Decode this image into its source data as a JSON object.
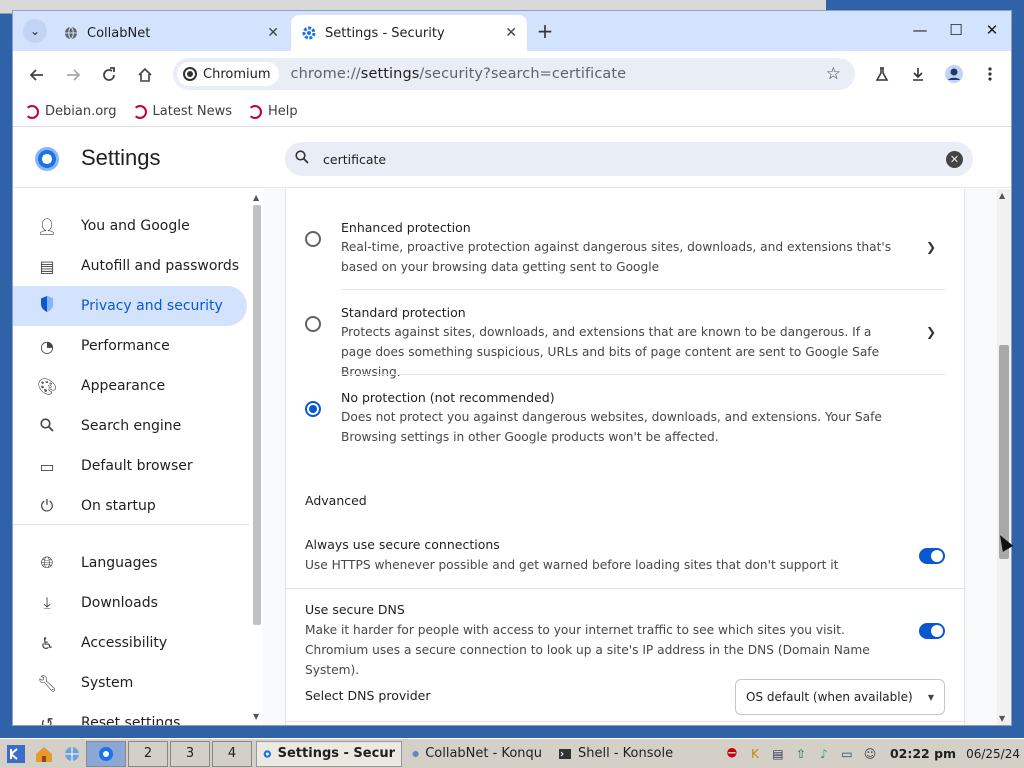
{
  "tabs": [
    {
      "title": "CollabNet",
      "close": "✕"
    },
    {
      "title": "Settings - Security",
      "close": "✕"
    }
  ],
  "tab_menu_glyph": "⌄",
  "new_tab_glyph": "+",
  "window_buttons": {
    "minimize": "—",
    "maximize": "☐",
    "close": "✕"
  },
  "omnibox": {
    "chip_label": "Chromium",
    "url_prefix": "chrome://",
    "url_host": "settings",
    "url_rest": "/security?search=certificate"
  },
  "bookmarks": [
    "Debian.org",
    "Latest News",
    "Help"
  ],
  "settings": {
    "title": "Settings",
    "search_value": "certificate"
  },
  "sidebar": {
    "items": [
      {
        "label": "You and Google",
        "icon": "person-icon"
      },
      {
        "label": "Autofill and passwords",
        "icon": "clipboard-icon"
      },
      {
        "label": "Privacy and security",
        "icon": "shield-icon",
        "active": true
      },
      {
        "label": "Performance",
        "icon": "speedometer-icon"
      },
      {
        "label": "Appearance",
        "icon": "palette-icon"
      },
      {
        "label": "Search engine",
        "icon": "search-icon"
      },
      {
        "label": "Default browser",
        "icon": "browser-icon"
      },
      {
        "label": "On startup",
        "icon": "power-icon"
      },
      {
        "label": "Languages",
        "icon": "globe-icon"
      },
      {
        "label": "Downloads",
        "icon": "download-icon"
      },
      {
        "label": "Accessibility",
        "icon": "accessibility-icon"
      },
      {
        "label": "System",
        "icon": "wrench-icon"
      },
      {
        "label": "Reset settings",
        "icon": "reset-icon"
      }
    ]
  },
  "protection": [
    {
      "title": "Enhanced protection",
      "desc": "Real-time, proactive protection against dangerous sites, downloads, and extensions that's based on your browsing data getting sent to Google",
      "checked": false
    },
    {
      "title": "Standard protection",
      "desc": "Protects against sites, downloads, and extensions that are known to be dangerous. If a page does something suspicious, URLs and bits of page content are sent to Google Safe Browsing.",
      "checked": false
    },
    {
      "title": "No protection (not recommended)",
      "desc": "Does not protect you against dangerous websites, downloads, and extensions. Your Safe Browsing settings in other Google products won't be affected.",
      "checked": true
    }
  ],
  "advanced": {
    "heading": "Advanced",
    "secure_connections": {
      "title": "Always use secure connections",
      "desc": "Use HTTPS whenever possible and get warned before loading sites that don't support it",
      "on": true
    },
    "secure_dns": {
      "title": "Use secure DNS",
      "desc": "Make it harder for people with access to your internet traffic to see which sites you visit. Chromium uses a secure connection to look up a site's IP address in the DNS (Domain Name System).",
      "on": true
    },
    "dns_provider": {
      "label": "Select DNS provider",
      "value": "OS default (when available)"
    }
  },
  "taskbar": {
    "desktops": [
      "2",
      "3",
      "4"
    ],
    "tasks": [
      "Settings - Secur",
      "CollabNet - Konqu",
      "Shell - Konsole"
    ],
    "clock": "02:22 pm",
    "date": "06/25/24"
  },
  "colors": {
    "accent": "#0b57d0",
    "tab_strip": "#d3e3fd",
    "active_nav": "#d3e3fd"
  }
}
